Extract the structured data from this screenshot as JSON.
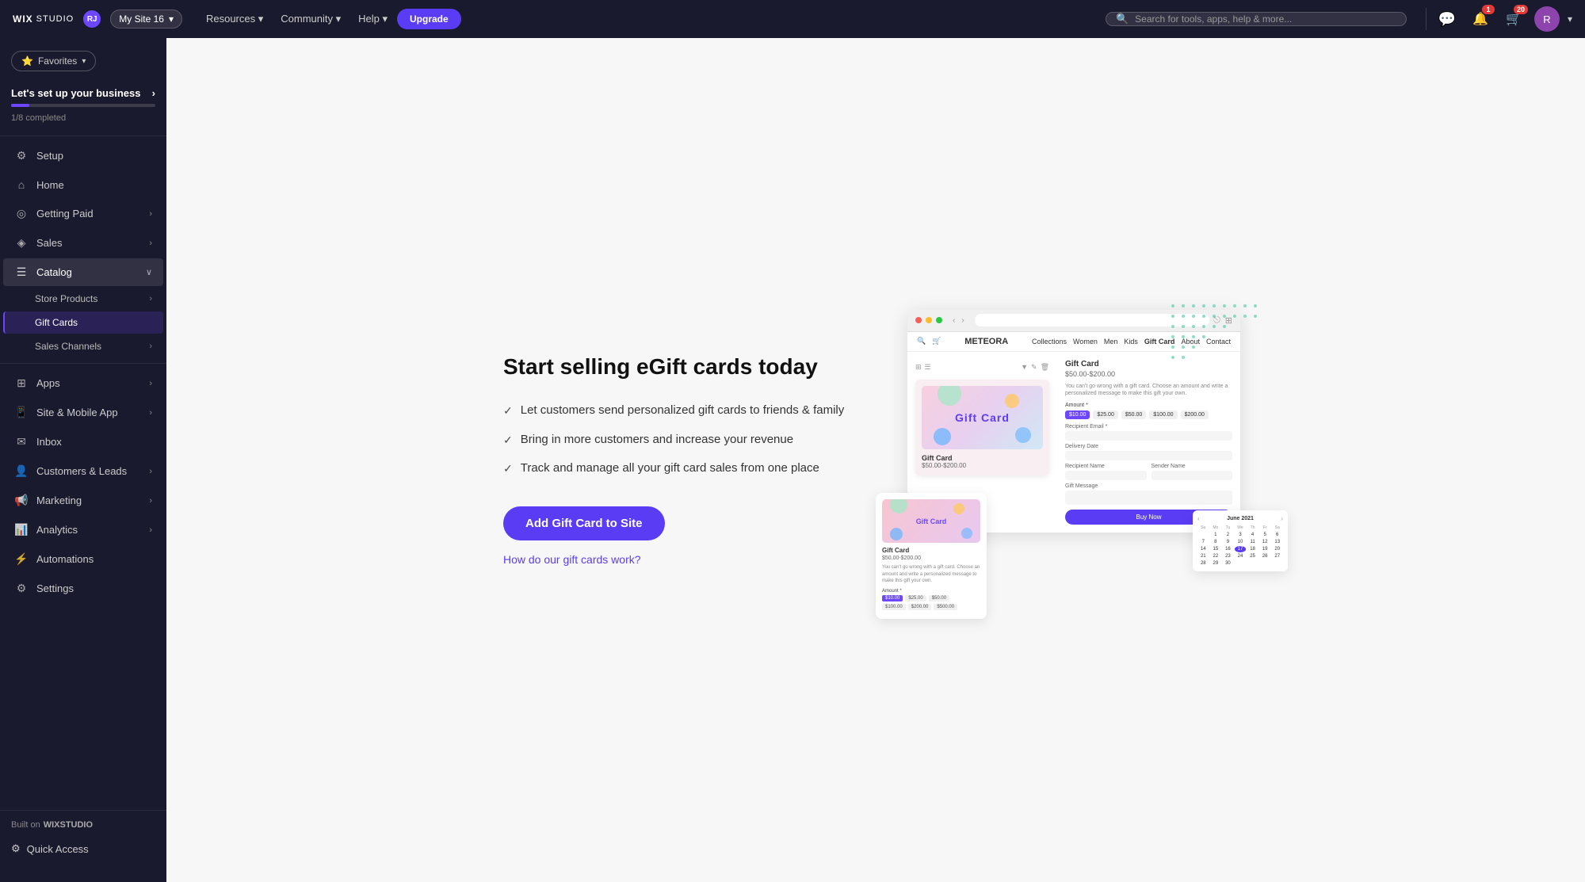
{
  "topnav": {
    "logo_wix": "WIX",
    "logo_studio": "STUDIO",
    "user_initials": "RJ",
    "site_name": "My Site 16",
    "links": [
      "Resources",
      "Community",
      "Help"
    ],
    "upgrade_label": "Upgrade",
    "search_placeholder": "Search for tools, apps, help & more...",
    "notification_badge": "1",
    "cart_badge": "20"
  },
  "sidebar": {
    "favorites_label": "Favorites",
    "business_setup_title": "Let's set up your business",
    "progress_text": "1/8 completed",
    "progress_percent": 12.5,
    "items": [
      {
        "id": "setup",
        "label": "Setup",
        "icon": "⚙",
        "has_arrow": false
      },
      {
        "id": "home",
        "label": "Home",
        "icon": "⌂",
        "has_arrow": false
      },
      {
        "id": "getting-paid",
        "label": "Getting Paid",
        "icon": "◎",
        "has_arrow": true
      },
      {
        "id": "sales",
        "label": "Sales",
        "icon": "◈",
        "has_arrow": true
      },
      {
        "id": "catalog",
        "label": "Catalog",
        "icon": "☰",
        "has_arrow": true,
        "expanded": true
      }
    ],
    "catalog_sub": [
      {
        "id": "store-products",
        "label": "Store Products",
        "has_arrow": true,
        "active": false
      },
      {
        "id": "gift-cards",
        "label": "Gift Cards",
        "has_arrow": false,
        "active": true
      },
      {
        "id": "sales-channels",
        "label": "Sales Channels",
        "has_arrow": true,
        "active": false
      }
    ],
    "items2": [
      {
        "id": "apps",
        "label": "Apps",
        "icon": "⊞",
        "has_arrow": true
      },
      {
        "id": "site-mobile",
        "label": "Site & Mobile App",
        "icon": "📱",
        "has_arrow": true
      },
      {
        "id": "inbox",
        "label": "Inbox",
        "icon": "✉",
        "has_arrow": false
      },
      {
        "id": "customers-leads",
        "label": "Customers & Leads",
        "icon": "👤",
        "has_arrow": true
      },
      {
        "id": "marketing",
        "label": "Marketing",
        "icon": "📢",
        "has_arrow": true
      },
      {
        "id": "analytics",
        "label": "Analytics",
        "icon": "📊",
        "has_arrow": true
      },
      {
        "id": "automations",
        "label": "Automations",
        "icon": "⚡",
        "has_arrow": false
      },
      {
        "id": "settings",
        "label": "Settings",
        "icon": "⚙",
        "has_arrow": false
      }
    ],
    "built_on": "Built on",
    "wix_studio": "WIXSTUDIO",
    "quick_access": "Quick Access"
  },
  "main": {
    "title": "Start selling eGift cards today",
    "features": [
      "Let customers send personalized gift cards to friends & family",
      "Bring in more customers and increase your revenue",
      "Track and manage all your gift card sales from one place"
    ],
    "add_btn": "Add Gift Card to Site",
    "how_link": "How do our gift cards work?",
    "illustration": {
      "store_logo": "METEORA",
      "store_nav": [
        "Collections",
        "Women",
        "Men",
        "Kids",
        "Gift Card",
        "About",
        "Contact"
      ],
      "product_title": "Gift Card",
      "product_price": "$50.00-$200.00",
      "product_desc": "You can't go wrong with a gift card. Choose an amount and write a personalized message to make this gift your own.",
      "amounts": [
        "$10.00",
        "$25.00",
        "$50.00",
        "$100.00",
        "$200.00"
      ],
      "amount_selected": "$10.00",
      "recipient_email_label": "Recipient Email *",
      "delivery_date_label": "Delivery Date",
      "recipient_name_label": "Recipient Name",
      "sender_name_label": "Sender Name",
      "gift_message_label": "Gift Message",
      "buy_now": "Buy Now",
      "calendar_month": "June 2021",
      "calendar_days_header": [
        "Su",
        "Mo",
        "Tu",
        "We",
        "Th",
        "Fr",
        "Sa"
      ],
      "calendar_days": [
        "",
        "",
        "1",
        "2",
        "3",
        "4",
        "5",
        "6",
        "7",
        "8",
        "9",
        "10",
        "11",
        "12",
        "13",
        "14",
        "15",
        "16",
        "17",
        "18",
        "19",
        "20",
        "21",
        "22",
        "23",
        "24",
        "25",
        "26",
        "27",
        "28",
        "29",
        "30",
        ""
      ],
      "calendar_selected": "17"
    }
  }
}
